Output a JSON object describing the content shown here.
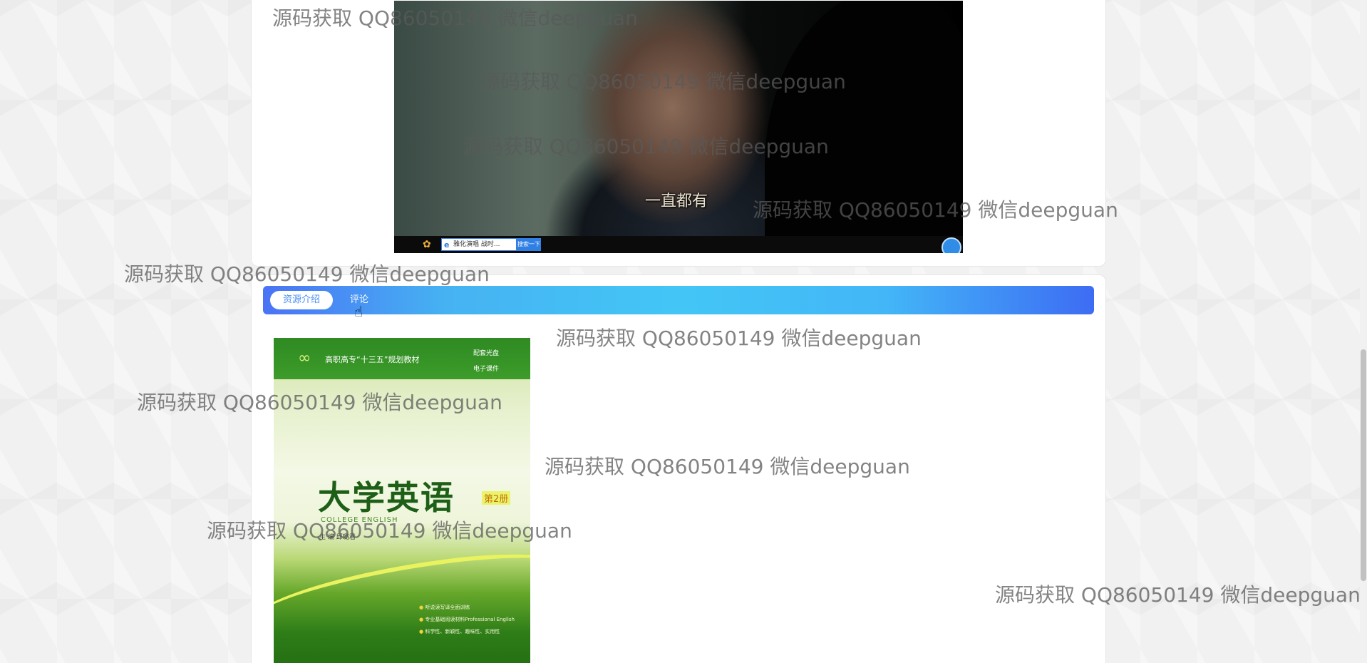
{
  "video": {
    "subtitle": "一直都有",
    "browser_search_text": "雅化演唱 战时...",
    "browser_search_button": "搜索一下"
  },
  "tabs": {
    "active": "资源介绍",
    "comments": "评论"
  },
  "book": {
    "series": "高职高专“十三五”规划教材",
    "badge_cd": "配套光盘",
    "badge_ebook": "电子课件",
    "title": "大学英语",
    "volume": "第2册",
    "english_title": "COLLEGE ENGLISH",
    "editor": "主 编  邱璐君",
    "bullets": [
      "听说读写译全面训练",
      "专业基础阅读材料Professional English",
      "科学性、新颖性、趣味性、实用性"
    ]
  },
  "watermark_text": "源码获取 QQ86050149 微信deepguan",
  "colors": {
    "tab_gradient_start": "#4a73f5",
    "tab_gradient_mid": "#43c6f6",
    "tab_gradient_end": "#3d6cf4",
    "active_tab_text": "#4a8ff2"
  }
}
